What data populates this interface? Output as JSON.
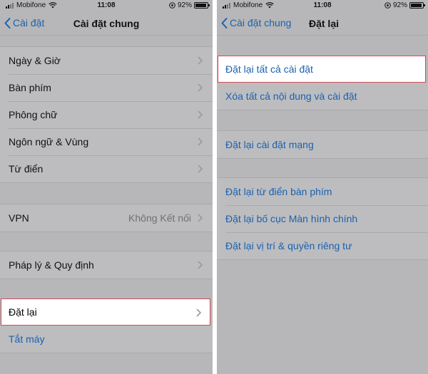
{
  "left": {
    "status": {
      "carrier": "Mobifone",
      "time": "11:08",
      "battery": "92%"
    },
    "back_label": "Cài đặt",
    "title": "Cài đặt chung",
    "group1": [
      {
        "label": "Ngày & Giờ"
      },
      {
        "label": "Bàn phím"
      },
      {
        "label": "Phông chữ"
      },
      {
        "label": "Ngôn ngữ & Vùng"
      },
      {
        "label": "Từ điển"
      }
    ],
    "vpn": {
      "label": "VPN",
      "value": "Không Kết nối"
    },
    "legal": {
      "label": "Pháp lý & Quy định"
    },
    "reset": {
      "label": "Đặt lại"
    },
    "shutdown": {
      "label": "Tắt máy"
    }
  },
  "right": {
    "status": {
      "carrier": "Mobifone",
      "time": "11:08",
      "battery": "92%"
    },
    "back_label": "Cài đặt chung",
    "title": "Đặt lại",
    "group1": [
      {
        "label": "Đặt lại tất cả cài đặt"
      },
      {
        "label": "Xóa tất cả nội dung và cài đặt"
      }
    ],
    "group2": [
      {
        "label": "Đặt lại cài đặt mạng"
      }
    ],
    "group3": [
      {
        "label": "Đặt lại từ điển bàn phím"
      },
      {
        "label": "Đặt lại bố cục Màn hình chính"
      },
      {
        "label": "Đặt lại vị trí & quyền riêng tư"
      }
    ]
  },
  "battery_level": 0.92,
  "colors": {
    "link": "#1b61b0",
    "background": "#b7b7b9",
    "highlight_border": "#d24a57"
  },
  "icons": [
    "back-chevron-icon",
    "chevron-right-icon",
    "wifi-icon",
    "signal-icon",
    "battery-icon",
    "location-icon"
  ]
}
